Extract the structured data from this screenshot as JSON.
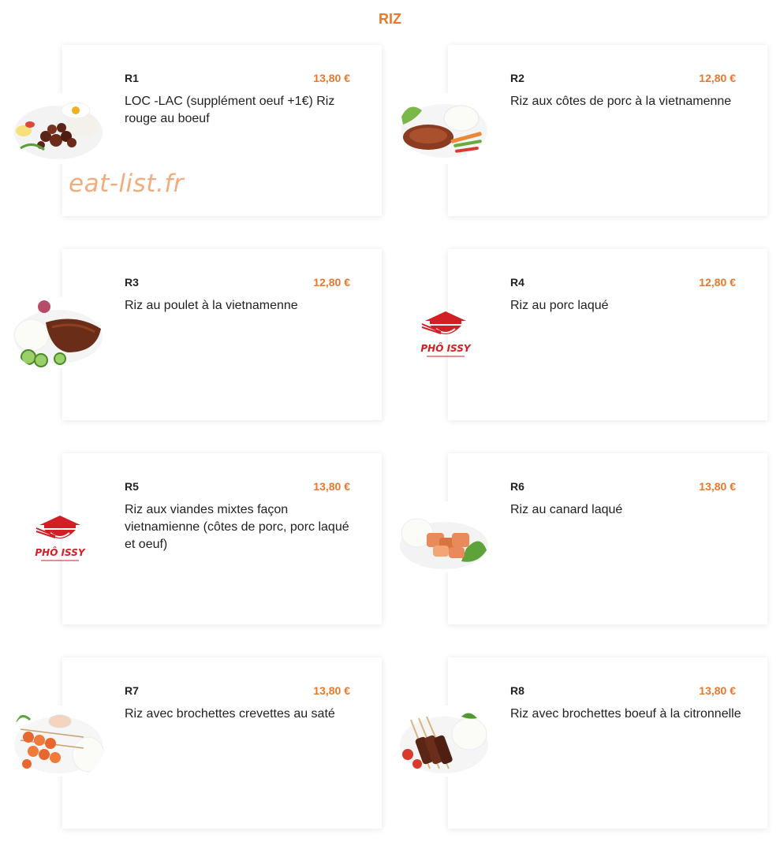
{
  "section": {
    "title": "RIZ"
  },
  "watermark": "eat-list.fr",
  "brand": {
    "accent": "#e8782a",
    "logo_text": "PHÔ ISSY",
    "logo_red": "#d21f26"
  },
  "items": [
    {
      "code": "R1",
      "price": "13,80 €",
      "desc": "LOC -LAC (supplément oeuf +1€) Riz rouge au boeuf",
      "image": "loc-lac-photo"
    },
    {
      "code": "R2",
      "price": "12,80 €",
      "desc": "Riz aux côtes de porc à la vietnamenne",
      "image": "pork-chop-rice-photo"
    },
    {
      "code": "R3",
      "price": "12,80 €",
      "desc": "Riz au poulet à la vietnamenne",
      "image": "chicken-rice-photo"
    },
    {
      "code": "R4",
      "price": "12,80 €",
      "desc": "Riz au porc laqué",
      "image": "pho-issy-logo"
    },
    {
      "code": "R5",
      "price": "13,80 €",
      "desc": "Riz aux viandes mixtes façon vietnamienne (côtes de porc, porc laqué et oeuf)",
      "image": "pho-issy-logo"
    },
    {
      "code": "R6",
      "price": "13,80 €",
      "desc": "Riz au canard laqué",
      "image": "duck-rice-photo"
    },
    {
      "code": "R7",
      "price": "13,80 €",
      "desc": "Riz avec brochettes crevettes au saté",
      "image": "shrimp-skewer-photo"
    },
    {
      "code": "R8",
      "price": "13,80 €",
      "desc": "Riz avec brochettes boeuf à la citronnelle",
      "image": "beef-skewer-photo"
    }
  ]
}
